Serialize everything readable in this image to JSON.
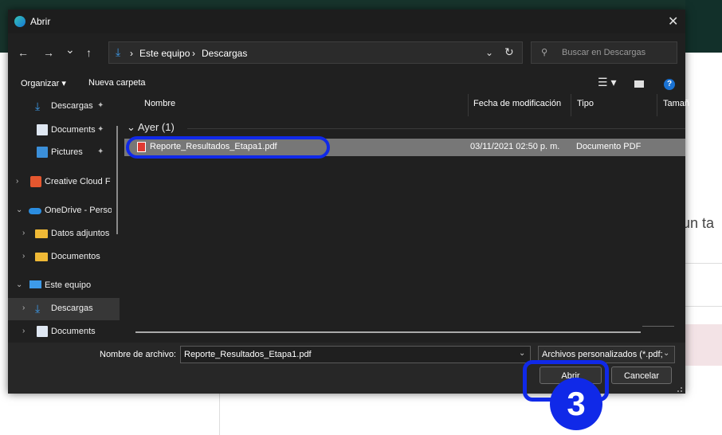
{
  "background_page": {
    "partial_text": "un ta",
    "header_color": "#17342c"
  },
  "dialog": {
    "title": "Abrir",
    "icons": {
      "app": "edge-icon",
      "close": "close-icon"
    },
    "nav": {
      "back": "←",
      "forward": "→",
      "recent": "⌄",
      "up": "↑"
    },
    "path": {
      "crumbs": [
        "Este equipo",
        "Descargas"
      ],
      "separator": "›"
    },
    "search": {
      "placeholder": "Buscar en Descargas"
    },
    "toolbar": {
      "organize": "Organizar ▾",
      "new_folder": "Nueva carpeta",
      "help": "?"
    },
    "sidebar": {
      "items": [
        {
          "label": "Descargas",
          "icon": "download-icon",
          "pinned": true
        },
        {
          "label": "Documents",
          "icon": "document-icon",
          "pinned": true
        },
        {
          "label": "Pictures",
          "icon": "pictures-icon",
          "pinned": true
        },
        {
          "label": "Creative Cloud F",
          "icon": "creative-cloud-icon",
          "expander": "›"
        },
        {
          "label": "OneDrive - Perso",
          "icon": "onedrive-icon",
          "expander": "⌄"
        },
        {
          "label": "Datos adjuntos",
          "icon": "folder-icon",
          "expander": "›"
        },
        {
          "label": "Documentos",
          "icon": "folder-icon",
          "expander": "›"
        },
        {
          "label": "Este equipo",
          "icon": "computer-icon",
          "expander": "⌄"
        },
        {
          "label": "Descargas",
          "icon": "download-icon",
          "expander": "›",
          "selected": true
        },
        {
          "label": "Documents",
          "icon": "document-icon",
          "expander": "›"
        }
      ]
    },
    "columns": [
      "Nombre",
      "Fecha de modificación",
      "Tipo",
      "Tamañ"
    ],
    "group": {
      "label": "Ayer (1)"
    },
    "files": [
      {
        "name": "Reporte_Resultados_Etapa1.pdf",
        "modified": "03/11/2021 02:50 p. m.",
        "type": "Documento PDF",
        "icon": "pdf-icon"
      }
    ],
    "footer": {
      "filename_label": "Nombre de archivo:",
      "filename_value": "Reporte_Resultados_Etapa1.pdf",
      "filter_value": "Archivos personalizados (*.pdf;",
      "open_label": "Abrir",
      "cancel_label": "Cancelar"
    }
  },
  "annotation": {
    "step_number": "3",
    "color": "#1029e8"
  }
}
